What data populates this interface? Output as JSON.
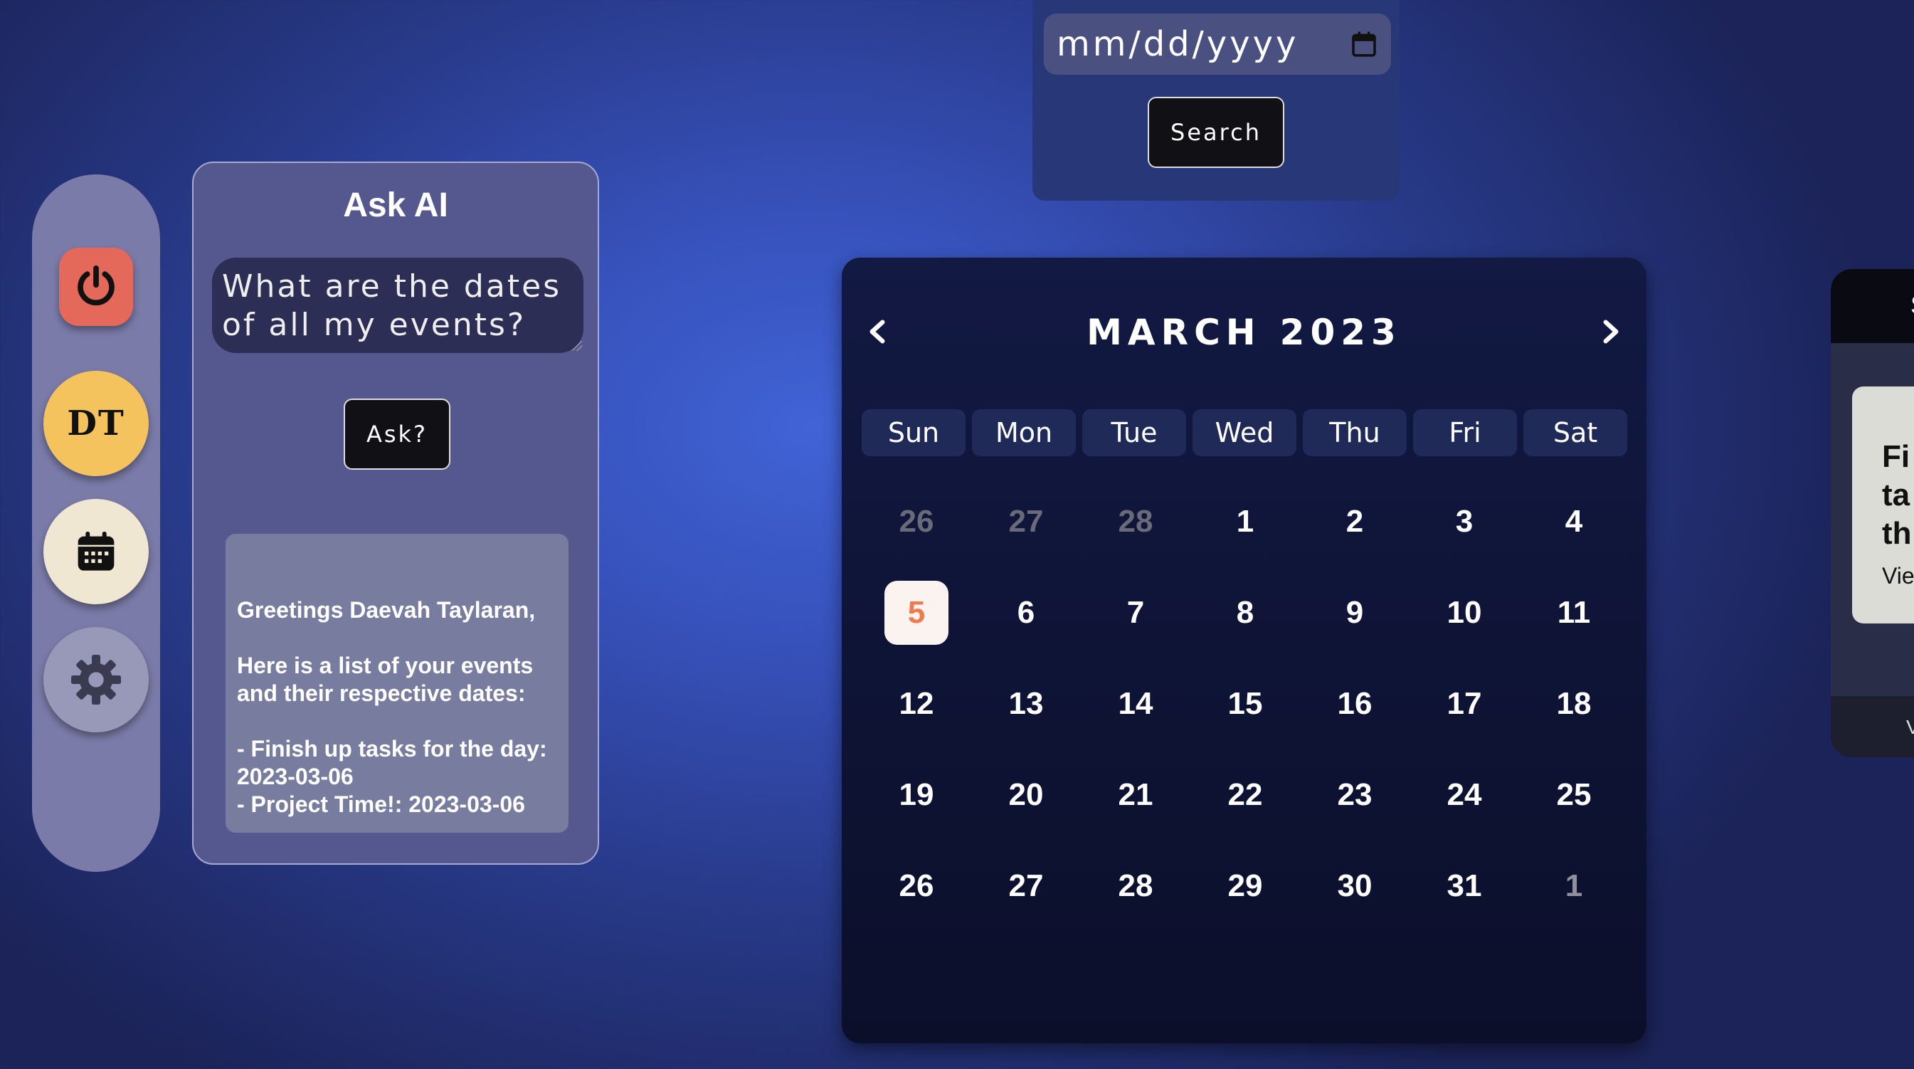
{
  "sidebar": {
    "power_icon": "power-icon",
    "avatar_initials": "DT",
    "calendar_icon": "calendar-icon",
    "settings_icon": "gear-icon"
  },
  "ask_ai": {
    "title": "Ask AI",
    "question": "What are the dates of all my events?",
    "button_label": "Ask?",
    "response": "Greetings Daevah Taylaran,\n\nHere is a list of your events and their respective dates:\n\n- Finish up tasks for the day: 2023-03-06\n- Project Time!: 2023-03-06"
  },
  "search": {
    "date_placeholder": "mm/dd/yyyy",
    "button_label": "Search"
  },
  "calendar": {
    "month": "MARCH",
    "year": "2023",
    "weekdays": [
      "Sun",
      "Mon",
      "Tue",
      "Wed",
      "Thu",
      "Fri",
      "Sat"
    ],
    "days": [
      {
        "label": "26",
        "state": "prev"
      },
      {
        "label": "27",
        "state": "prev"
      },
      {
        "label": "28",
        "state": "prev"
      },
      {
        "label": "1"
      },
      {
        "label": "2"
      },
      {
        "label": "3"
      },
      {
        "label": "4"
      },
      {
        "label": "5",
        "state": "today"
      },
      {
        "label": "6"
      },
      {
        "label": "7"
      },
      {
        "label": "8"
      },
      {
        "label": "9"
      },
      {
        "label": "10"
      },
      {
        "label": "11"
      },
      {
        "label": "12"
      },
      {
        "label": "13"
      },
      {
        "label": "14"
      },
      {
        "label": "15"
      },
      {
        "label": "16"
      },
      {
        "label": "17"
      },
      {
        "label": "18"
      },
      {
        "label": "19"
      },
      {
        "label": "20"
      },
      {
        "label": "21"
      },
      {
        "label": "22"
      },
      {
        "label": "23"
      },
      {
        "label": "24"
      },
      {
        "label": "25"
      },
      {
        "label": "26"
      },
      {
        "label": "27"
      },
      {
        "label": "28"
      },
      {
        "label": "29"
      },
      {
        "label": "30"
      },
      {
        "label": "31"
      },
      {
        "label": "1",
        "state": "next"
      }
    ]
  },
  "event_panel": {
    "header_text": "S",
    "card_title": "Fi\nta\nth",
    "card_link": "Vie",
    "footer_text": "V"
  },
  "colors": {
    "today_accent": "#ef7a4e",
    "power_button": "#e5695b",
    "avatar_bg": "#f5c35e"
  }
}
